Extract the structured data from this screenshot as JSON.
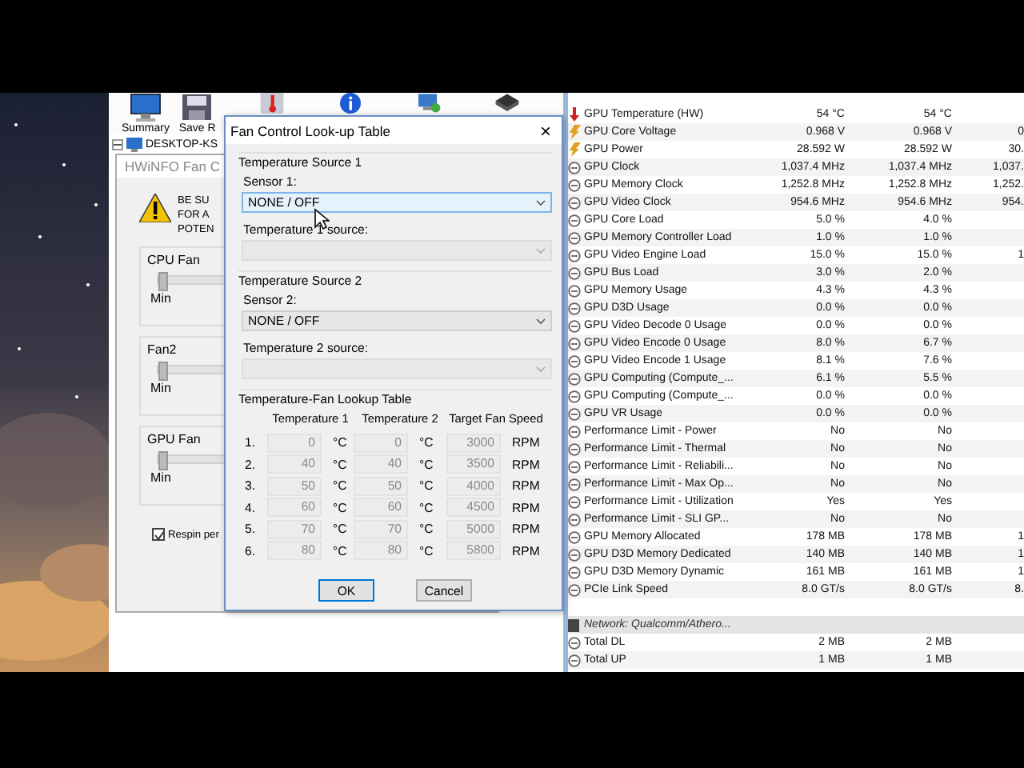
{
  "main_window": {
    "toolbar": [
      {
        "kind": "monitor",
        "label": "Summary"
      },
      {
        "kind": "disk",
        "label": "Save R"
      },
      {
        "kind": "thermometer"
      },
      {
        "kind": "info"
      },
      {
        "kind": "network"
      },
      {
        "kind": "chip"
      }
    ],
    "tree_item": {
      "label": "DESKTOP-KS",
      "expanded": true
    }
  },
  "fan_window": {
    "title": "HWiNFO Fan C",
    "warning_lines": [
      "BE SU",
      "FOR A",
      "POTEN"
    ],
    "fans": [
      {
        "name": "CPU Fan",
        "min_label": "Min",
        "level": 0
      },
      {
        "name": "Fan2",
        "min_label": "Min",
        "level": 0
      },
      {
        "name": "GPU Fan",
        "min_label": "Min",
        "level": 0
      }
    ],
    "respin": {
      "label": "Respin per",
      "checked": true
    }
  },
  "dialog": {
    "title": "Fan Control Look-up Table",
    "close": "×",
    "sources": [
      {
        "heading": "Temperature Source 1",
        "sensor_label": "Sensor 1:",
        "sensor_value": "NONE / OFF",
        "sensor_focused": true,
        "source_label": "Temperature 1 source:",
        "source_disabled": true
      },
      {
        "heading": "Temperature Source 2",
        "sensor_label": "Sensor 2:",
        "sensor_value": "NONE / OFF",
        "sensor_focused": false,
        "source_label": "Temperature 2 source:",
        "source_disabled": true
      }
    ],
    "table": {
      "heading": "Temperature-Fan Lookup Table",
      "columns": [
        "Temperature 1",
        "Temperature 2",
        "Target Fan Speed"
      ],
      "disabled": true,
      "rows": [
        {
          "index": "1.",
          "temp1": "0",
          "unit1": "°C",
          "temp2": "0",
          "unit2": "°C",
          "speed": "3000",
          "speed_unit": "RPM"
        },
        {
          "index": "2.",
          "temp1": "40",
          "unit1": "°C",
          "temp2": "40",
          "unit2": "°C",
          "speed": "3500",
          "speed_unit": "RPM"
        },
        {
          "index": "3.",
          "temp1": "50",
          "unit1": "°C",
          "temp2": "50",
          "unit2": "°C",
          "speed": "4000",
          "speed_unit": "RPM"
        },
        {
          "index": "4.",
          "temp1": "60",
          "unit1": "°C",
          "temp2": "60",
          "unit2": "°C",
          "speed": "4500",
          "speed_unit": "RPM"
        },
        {
          "index": "5.",
          "temp1": "70",
          "unit1": "°C",
          "temp2": "70",
          "unit2": "°C",
          "speed": "5000",
          "speed_unit": "RPM"
        },
        {
          "index": "6.",
          "temp1": "80",
          "unit1": "°C",
          "temp2": "80",
          "unit2": "°C",
          "speed": "5800",
          "speed_unit": "RPM"
        }
      ]
    },
    "buttons": [
      {
        "label": "OK",
        "default": true
      },
      {
        "label": "Cancel",
        "default": false
      }
    ]
  },
  "sensors": {
    "rows": [
      {
        "kind": "temperature",
        "name": "GPU Temperature (HW)",
        "current": "54 °C",
        "minimum": "54 °C"
      },
      {
        "kind": "voltage",
        "name": "GPU Core Voltage",
        "current": "0.968 V",
        "minimum": "0.968 V",
        "column_3": "0"
      },
      {
        "kind": "voltage",
        "name": "GPU Power",
        "current": "28.592 W",
        "minimum": "28.592 W",
        "column_3": "30."
      },
      {
        "kind": "gauge",
        "name": "GPU Clock",
        "current": "1,037.4 MHz",
        "minimum": "1,037.4 MHz",
        "column_3": "1,037."
      },
      {
        "kind": "gauge",
        "name": "GPU Memory Clock",
        "current": "1,252.8 MHz",
        "minimum": "1,252.8 MHz",
        "column_3": "1,252."
      },
      {
        "kind": "gauge",
        "name": "GPU Video Clock",
        "current": "954.6 MHz",
        "minimum": "954.6 MHz",
        "column_3": "954."
      },
      {
        "kind": "gauge",
        "name": "GPU Core Load",
        "current": "5.0 %",
        "minimum": "4.0 %"
      },
      {
        "kind": "gauge",
        "name": "GPU Memory Controller Load",
        "current": "1.0 %",
        "minimum": "1.0 %"
      },
      {
        "kind": "gauge",
        "name": "GPU Video Engine Load",
        "current": "15.0 %",
        "minimum": "15.0 %",
        "column_3": "1"
      },
      {
        "kind": "gauge",
        "name": "GPU Bus Load",
        "current": "3.0 %",
        "minimum": "2.0 %"
      },
      {
        "kind": "gauge",
        "name": "GPU Memory Usage",
        "current": "4.3 %",
        "minimum": "4.3 %"
      },
      {
        "kind": "gauge",
        "name": "GPU D3D Usage",
        "current": "0.0 %",
        "minimum": "0.0 %"
      },
      {
        "kind": "gauge",
        "name": "GPU Video Decode 0 Usage",
        "current": "0.0 %",
        "minimum": "0.0 %"
      },
      {
        "kind": "gauge",
        "name": "GPU Video Encode 0 Usage",
        "current": "8.0 %",
        "minimum": "6.7 %"
      },
      {
        "kind": "gauge",
        "name": "GPU Video Encode 1 Usage",
        "current": "8.1 %",
        "minimum": "7.6 %"
      },
      {
        "kind": "gauge",
        "name": "GPU Computing (Compute_...",
        "current": "6.1 %",
        "minimum": "5.5 %"
      },
      {
        "kind": "gauge",
        "name": "GPU Computing (Compute_...",
        "current": "0.0 %",
        "minimum": "0.0 %"
      },
      {
        "kind": "gauge",
        "name": "GPU VR Usage",
        "current": "0.0 %",
        "minimum": "0.0 %"
      },
      {
        "kind": "gauge",
        "name": "Performance Limit - Power",
        "current": "No",
        "minimum": "No"
      },
      {
        "kind": "gauge",
        "name": "Performance Limit - Thermal",
        "current": "No",
        "minimum": "No"
      },
      {
        "kind": "gauge",
        "name": "Performance Limit - Reliabili...",
        "current": "No",
        "minimum": "No"
      },
      {
        "kind": "gauge",
        "name": "Performance Limit - Max Op...",
        "current": "No",
        "minimum": "No"
      },
      {
        "kind": "gauge",
        "name": "Performance Limit - Utilization",
        "current": "Yes",
        "minimum": "Yes"
      },
      {
        "kind": "gauge",
        "name": "Performance Limit - SLI GP...",
        "current": "No",
        "minimum": "No"
      },
      {
        "kind": "gauge",
        "name": "GPU Memory Allocated",
        "current": "178 MB",
        "minimum": "178 MB",
        "column_3": "1"
      },
      {
        "kind": "gauge",
        "name": "GPU D3D Memory Dedicated",
        "current": "140 MB",
        "minimum": "140 MB",
        "column_3": "1"
      },
      {
        "kind": "gauge",
        "name": "GPU D3D Memory Dynamic",
        "current": "161 MB",
        "minimum": "161 MB",
        "column_3": "1"
      },
      {
        "kind": "gauge",
        "name": "PCIe Link Speed",
        "current": "8.0 GT/s",
        "minimum": "8.0 GT/s",
        "column_3": "8."
      },
      {
        "kind": "blank"
      },
      {
        "kind": "group",
        "name": "Network: Qualcomm/Athero..."
      },
      {
        "kind": "gauge",
        "name": "Total DL",
        "current": "2 MB",
        "minimum": "2 MB"
      },
      {
        "kind": "gauge",
        "name": "Total UP",
        "current": "1 MB",
        "minimum": "1 MB"
      }
    ]
  }
}
